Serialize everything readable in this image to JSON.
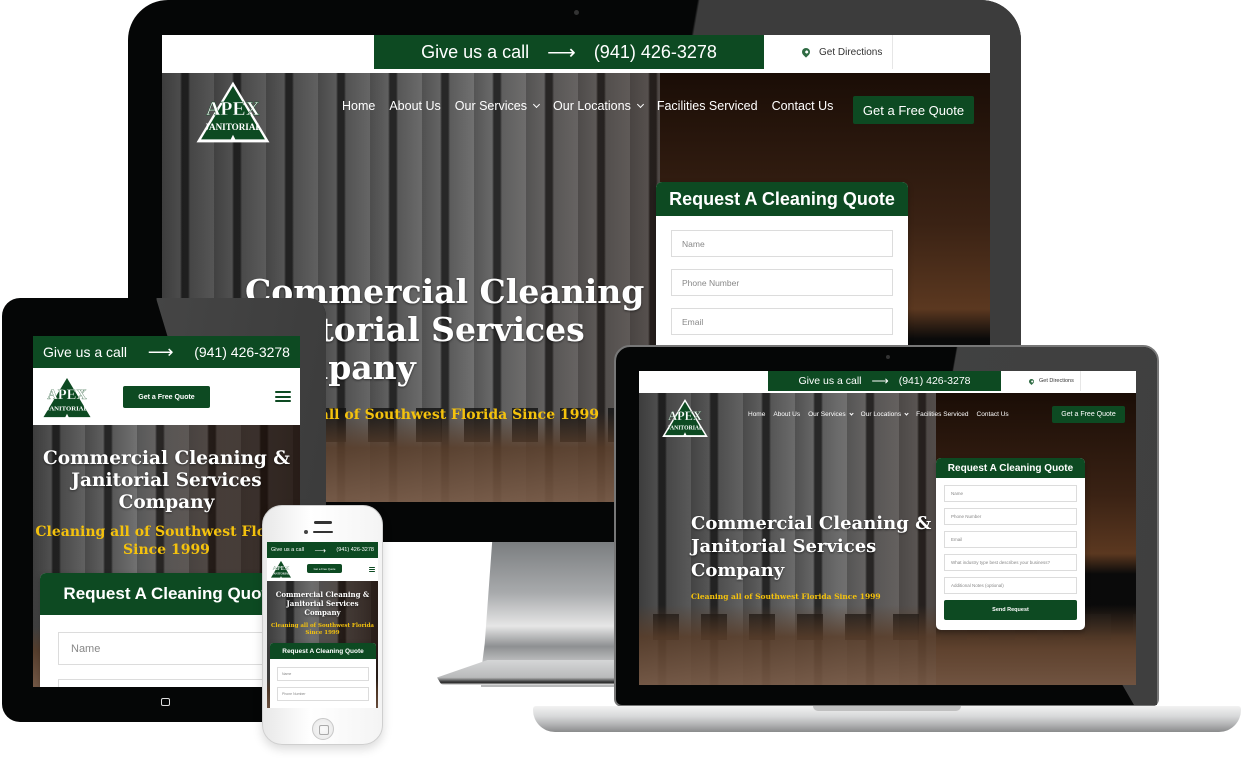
{
  "brand": {
    "logo_top": "APEX",
    "logo_bottom": "JANITORIAL",
    "primary_color": "#0d4a22",
    "accent_color": "#f4c20d"
  },
  "topbar": {
    "call_label": "Give us a call",
    "arrow_icon": "arrow-right-icon",
    "phone": "(941) 426-3278",
    "directions_icon": "map-pin-icon",
    "directions_label": "Get Directions"
  },
  "nav": {
    "items": [
      {
        "label": "Home",
        "has_dropdown": false
      },
      {
        "label": "About Us",
        "has_dropdown": false
      },
      {
        "label": "Our Services",
        "has_dropdown": true
      },
      {
        "label": "Our Locations",
        "has_dropdown": true
      },
      {
        "label": "Facilities Serviced",
        "has_dropdown": false
      },
      {
        "label": "Contact Us",
        "has_dropdown": false
      }
    ],
    "cta_label": "Get a Free Quote",
    "menu_icon": "hamburger-menu-icon"
  },
  "hero": {
    "title_line1": "Commercial Cleaning &",
    "title_line2": "Janitorial Services",
    "title_line3": "Company",
    "subtitle": "Cleaning all of Southwest Florida Since 1999",
    "subtitle_line1": "Cleaning all of Southwest Florida",
    "subtitle_line2": "Since 1999"
  },
  "quote_form": {
    "title": "Request A Cleaning Quote",
    "fields": [
      {
        "placeholder": "Name"
      },
      {
        "placeholder": "Phone Number"
      },
      {
        "placeholder": "Email"
      },
      {
        "placeholder": "What industry type best describes your business?"
      },
      {
        "placeholder": "Additional Notes (optional)"
      }
    ],
    "submit_label": "Send Request"
  }
}
